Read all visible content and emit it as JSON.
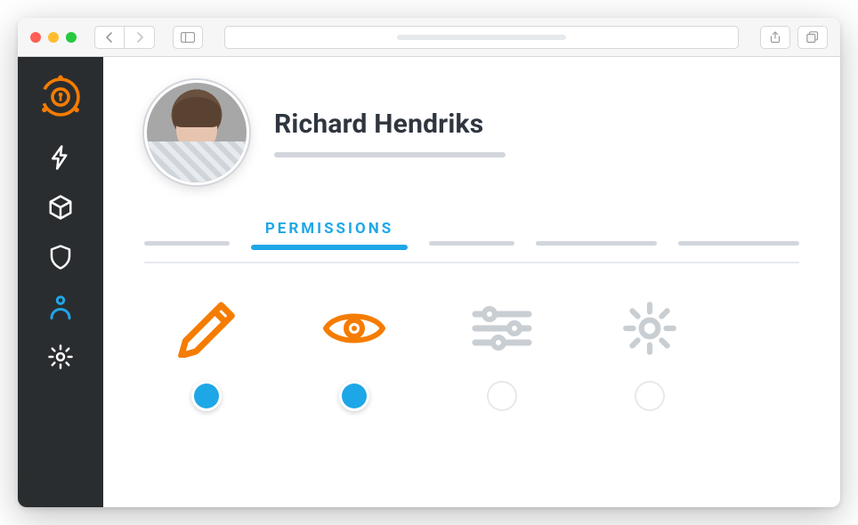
{
  "user": {
    "name": "Richard Hendriks"
  },
  "tabs": {
    "active_label": "PERMISSIONS"
  },
  "sidebar": {
    "items": [
      {
        "name": "lightning",
        "active": false
      },
      {
        "name": "cube",
        "active": false
      },
      {
        "name": "shield",
        "active": false
      },
      {
        "name": "user",
        "active": true
      },
      {
        "name": "gear",
        "active": false
      }
    ]
  },
  "permissions": [
    {
      "name": "edit",
      "icon": "pencil-icon",
      "enabled": true
    },
    {
      "name": "view",
      "icon": "eye-icon",
      "enabled": true
    },
    {
      "name": "adjust",
      "icon": "sliders-icon",
      "enabled": false
    },
    {
      "name": "settings",
      "icon": "gear-icon",
      "enabled": false
    }
  ],
  "colors": {
    "orange": "#f57c00",
    "blue": "#1ea7e7",
    "sidebar_bg": "#2a2d30"
  }
}
